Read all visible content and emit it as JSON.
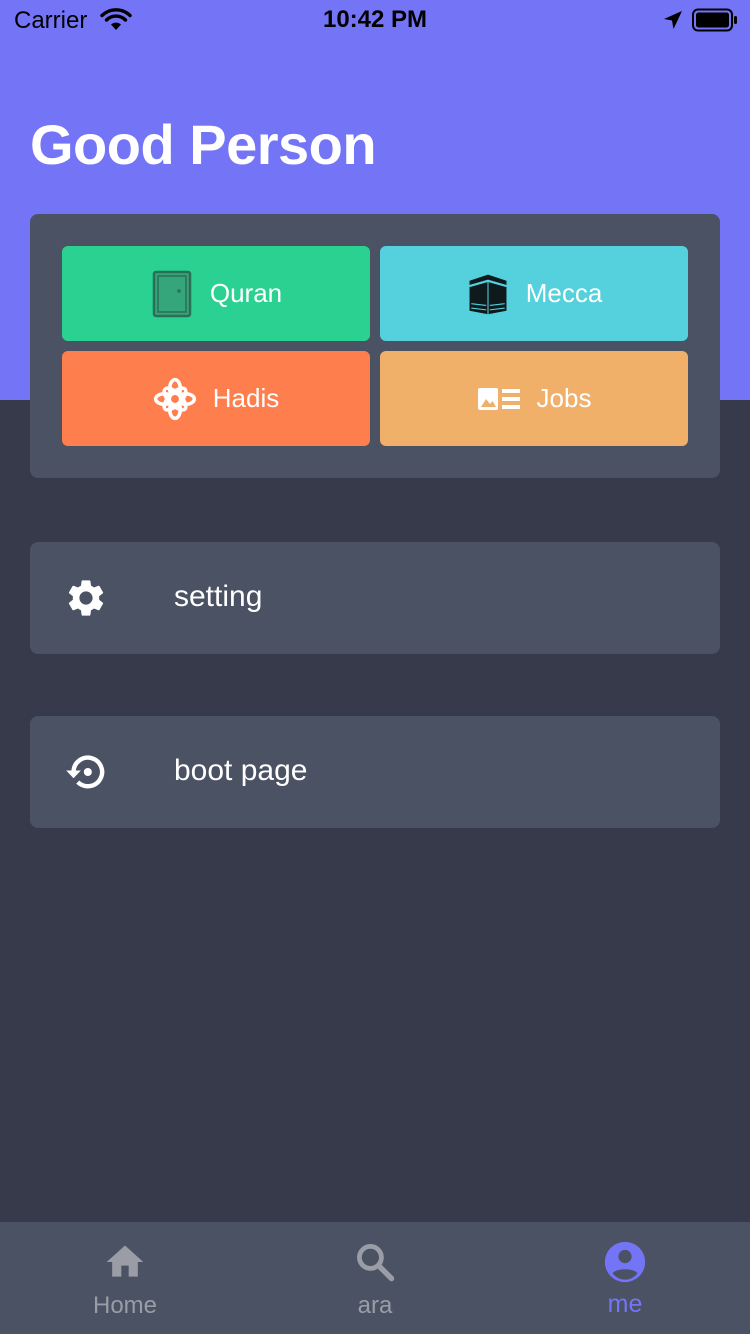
{
  "status_bar": {
    "carrier": "Carrier",
    "time": "10:42 PM"
  },
  "header": {
    "title": "Good Person"
  },
  "grid": {
    "buttons": [
      {
        "label": "Quran",
        "icon": "quran-book-icon",
        "color": "#2bd190"
      },
      {
        "label": "Mecca",
        "icon": "kaaba-icon",
        "color": "#54d1dd"
      },
      {
        "label": "Hadis",
        "icon": "ornament-icon",
        "color": "#ff7e4d"
      },
      {
        "label": "Jobs",
        "icon": "article-icon",
        "color": "#f0b06a"
      }
    ]
  },
  "list": {
    "items": [
      {
        "label": "setting",
        "icon": "gear-icon"
      },
      {
        "label": "boot page",
        "icon": "restore-icon"
      }
    ]
  },
  "tab_bar": {
    "tabs": [
      {
        "label": "Home",
        "icon": "home-icon",
        "active": false
      },
      {
        "label": "ara",
        "icon": "search-icon",
        "active": false
      },
      {
        "label": "me",
        "icon": "account-circle-icon",
        "active": true
      }
    ]
  },
  "colors": {
    "header_bg": "#7474f7",
    "page_bg": "#363a4a",
    "card_bg": "#4a5263",
    "active_tab": "#7474f7",
    "inactive_tab": "#9a9da6"
  }
}
